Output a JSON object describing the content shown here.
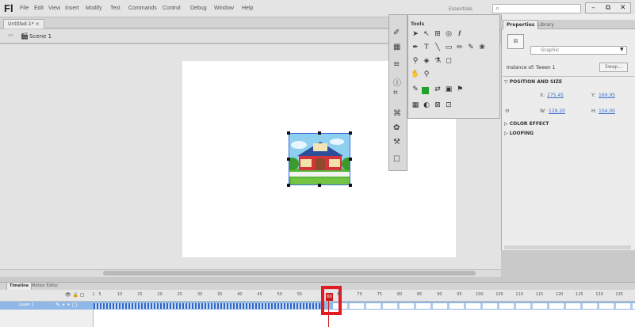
{
  "app": {
    "logo": "Fl"
  },
  "menu": [
    "File",
    "Edit",
    "View",
    "Insert",
    "Modify",
    "Text",
    "Commands",
    "Control",
    "Debug",
    "Window",
    "Help"
  ],
  "workspace": {
    "essentials_label": "Essentials",
    "window_controls": [
      "–",
      "⧉",
      "✕"
    ]
  },
  "document": {
    "tab": "Untitled-1* ×",
    "scene": "Scene 1"
  },
  "tools": {
    "title": "Tools"
  },
  "properties": {
    "tabs": [
      "Properties",
      "Library"
    ],
    "type_value": "Graphic",
    "instance_label": "Instance of: Tween 1",
    "swap_label": "Swap...",
    "sections": [
      "POSITION AND SIZE",
      "COLOR EFFECT",
      "LOOPING"
    ],
    "x_label": "X:",
    "x_value": "275.45",
    "y_label": "Y:",
    "y_value": "169.95",
    "w_label": "W:",
    "w_value": "129.20",
    "h_label": "H:",
    "h_value": "104.00"
  },
  "timeline": {
    "tabs": [
      "Timeline",
      "Motion Editor"
    ],
    "layer": "Layer 1",
    "ruler": [
      "1",
      "5",
      "10",
      "15",
      "20",
      "25",
      "30",
      "35",
      "40",
      "45",
      "50",
      "55",
      "60",
      "65",
      "70",
      "75",
      "80",
      "85",
      "90",
      "95",
      "100",
      "105",
      "110",
      "115",
      "120",
      "125",
      "130",
      "135"
    ],
    "current_frame": "60"
  },
  "colors": {
    "highlight": "#e11b22",
    "selection": "#3b6fd8",
    "layer_row": "#8fb8e8"
  }
}
